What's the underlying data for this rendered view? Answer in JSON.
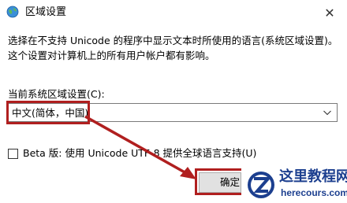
{
  "window": {
    "title": "区域设置",
    "close_glyph": "✕"
  },
  "description": "选择在不支持 Unicode 的程序中显示文本时所使用的语言(系统区域设置)。这个设置对计算机上的所有用户帐户都有影响。",
  "locale": {
    "label": "当前系统区域设置(C):",
    "selected": "中文(简体，中国)"
  },
  "beta_option": {
    "label": "Beta 版: 使用 Unicode UTF-8 提供全球语言支持(U)",
    "checked": false
  },
  "ok_button": {
    "label": "确定"
  },
  "watermark": {
    "cn": "这里教程网",
    "en": "herecours.com"
  },
  "colors": {
    "annotation": "#b01f1f",
    "watermark": "#1c3f8f"
  },
  "icons": [
    "globe-icon",
    "close-icon",
    "chevron-down-icon",
    "arrow-annotation",
    "watermark-logo"
  ]
}
